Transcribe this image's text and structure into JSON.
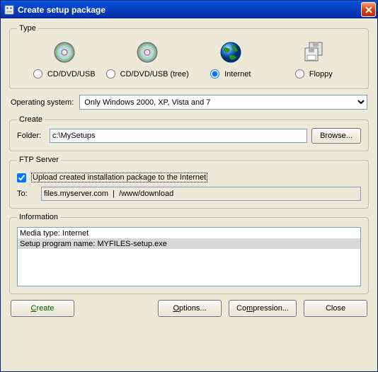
{
  "window": {
    "title": "Create setup package"
  },
  "type_group": {
    "legend": "Type",
    "options": {
      "cd": "CD/DVD/USB",
      "cdtree": "CD/DVD/USB (tree)",
      "internet": "Internet",
      "floppy": "Floppy"
    },
    "selected": "internet"
  },
  "os": {
    "label": "Operating system:",
    "value": "Only Windows 2000, XP, Vista and 7"
  },
  "create_group": {
    "legend": "Create",
    "folder_label": "Folder:",
    "folder_value": "c:\\MySetups",
    "browse": "Browse..."
  },
  "ftp_group": {
    "legend": "FTP Server",
    "upload_label": "Upload created installation package to the Internet",
    "upload_checked": true,
    "to_label": "To:",
    "to_value": "files.myserver.com  |  /www/download"
  },
  "info_group": {
    "legend": "Information",
    "line1": "Media type: Internet",
    "line2": "Setup program name: MYFILES-setup.exe"
  },
  "buttons": {
    "create": "Create",
    "options": "Options...",
    "compression": "Compression...",
    "close": "Close"
  }
}
